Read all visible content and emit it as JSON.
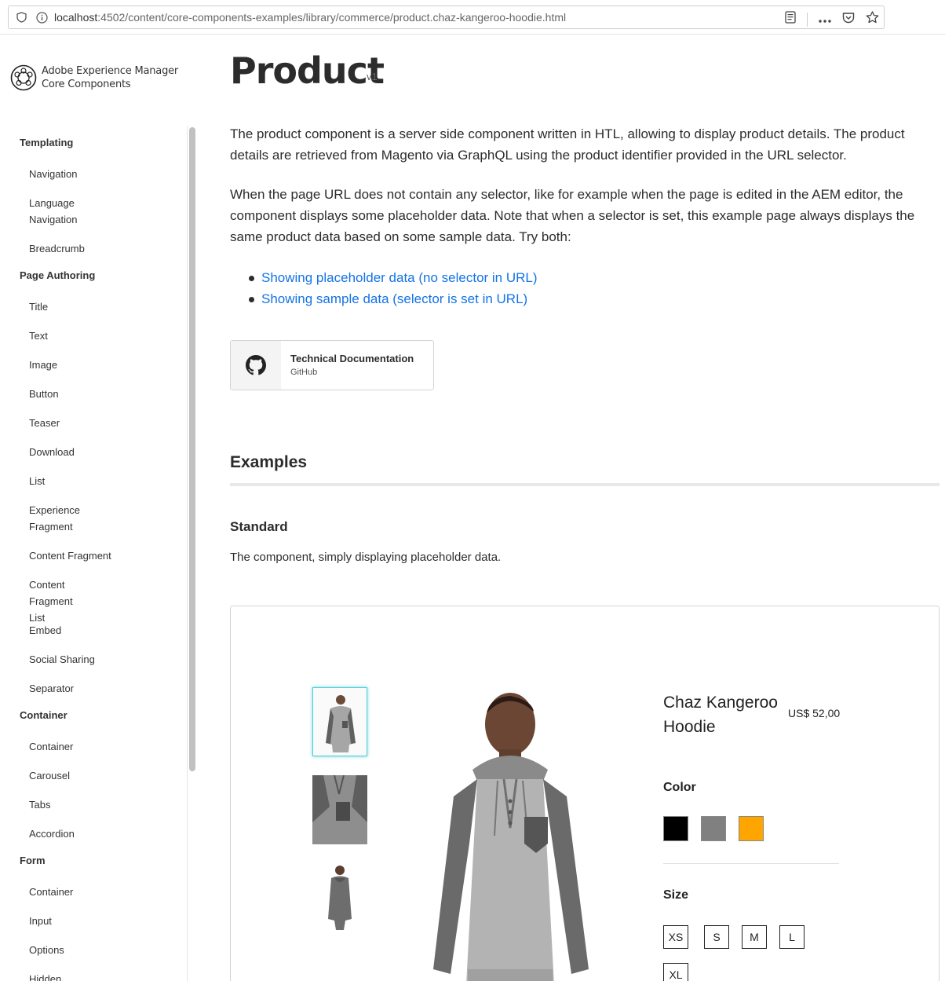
{
  "browser": {
    "url_host": "localhost",
    "url_path": ":4502/content/core-components-examples/library/commerce/product.chaz-kangeroo-hoodie.html"
  },
  "logo": {
    "line1": "Adobe Experience Manager",
    "line2": "Core Components"
  },
  "nav": [
    {
      "type": "group",
      "label": "Templating"
    },
    {
      "type": "item",
      "label": "Navigation"
    },
    {
      "type": "item",
      "label": "Language Navigation"
    },
    {
      "type": "item",
      "label": "Breadcrumb"
    },
    {
      "type": "group",
      "label": "Page Authoring"
    },
    {
      "type": "item",
      "label": "Title"
    },
    {
      "type": "item",
      "label": "Text"
    },
    {
      "type": "item",
      "label": "Image"
    },
    {
      "type": "item",
      "label": "Button"
    },
    {
      "type": "item",
      "label": "Teaser"
    },
    {
      "type": "item",
      "label": "Download"
    },
    {
      "type": "item",
      "label": "List"
    },
    {
      "type": "item",
      "label": "Experience Fragment"
    },
    {
      "type": "item",
      "label": "Content Fragment"
    },
    {
      "type": "item",
      "label": "Content Fragment List"
    },
    {
      "type": "item",
      "label": "Embed"
    },
    {
      "type": "item",
      "label": "Social Sharing"
    },
    {
      "type": "item",
      "label": "Separator"
    },
    {
      "type": "group",
      "label": "Container"
    },
    {
      "type": "item",
      "label": "Container"
    },
    {
      "type": "item",
      "label": "Carousel"
    },
    {
      "type": "item",
      "label": "Tabs"
    },
    {
      "type": "item",
      "label": "Accordion"
    },
    {
      "type": "group",
      "label": "Form"
    },
    {
      "type": "item",
      "label": "Container"
    },
    {
      "type": "item",
      "label": "Input"
    },
    {
      "type": "item",
      "label": "Options"
    },
    {
      "type": "item",
      "label": "Hidden"
    }
  ],
  "page": {
    "title": "Product",
    "version": "v1",
    "para1": "The product component is a server side component written in HTL, allowing to display product details. The product details are retrieved from Magento via GraphQL using the product identifier provided in the URL selector.",
    "para2": "When the page URL does not contain any selector, like for example when the page is edited in the AEM editor, the component displays some placeholder data. Note that when a selector is set, this example page always displays the same product data based on some sample data. Try both:",
    "link1": "Showing placeholder data (no selector in URL)",
    "link2": "Showing sample data (selector is set in URL)",
    "doc_title": "Technical Documentation",
    "doc_sub": "GitHub",
    "examples_heading": "Examples",
    "standard_heading": "Standard",
    "standard_desc": "The component, simply displaying placeholder data."
  },
  "product": {
    "name": "Chaz Kangeroo Hoodie",
    "price": "US$ 52,00",
    "color_label": "Color",
    "colors": [
      "#000000",
      "#808080",
      "#ffa500"
    ],
    "size_label": "Size",
    "sizes": [
      "XS",
      "S",
      "M",
      "L",
      "XL"
    ]
  }
}
